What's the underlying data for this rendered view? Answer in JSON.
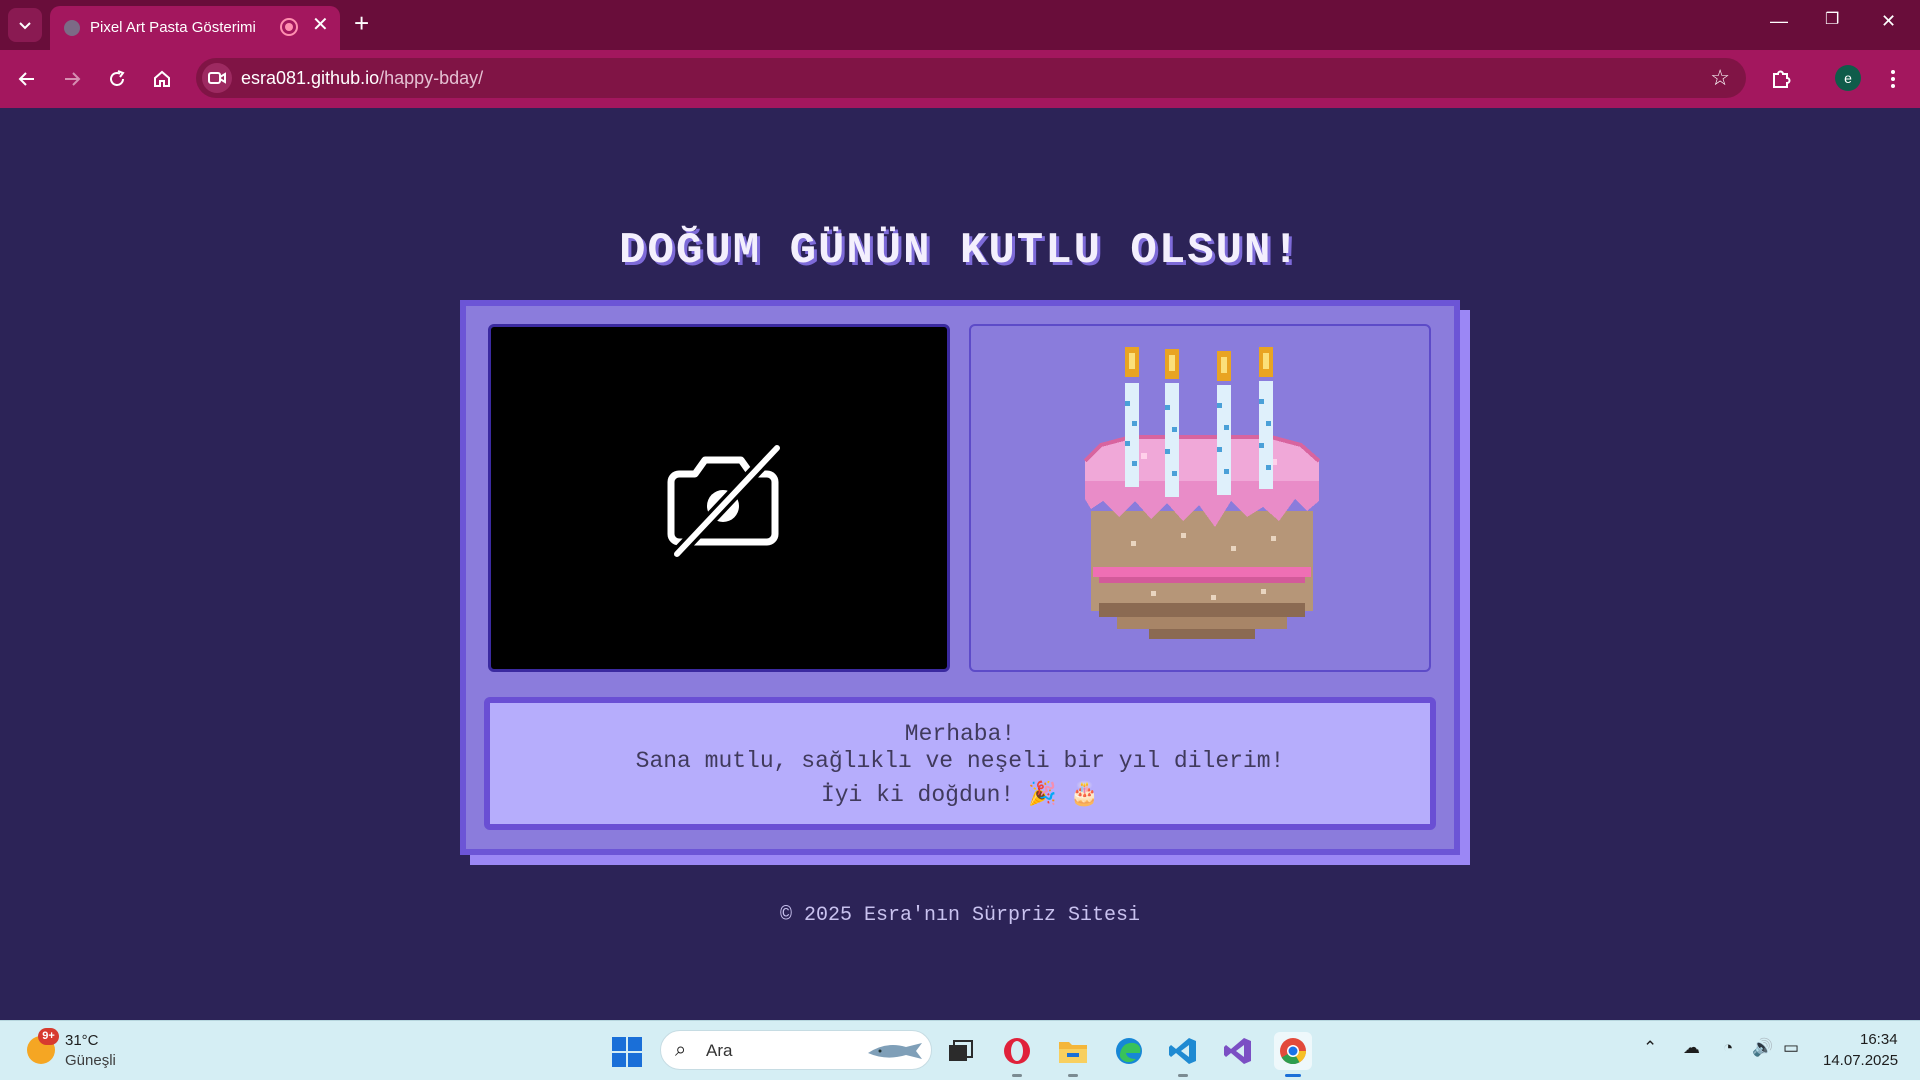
{
  "browser": {
    "tab_title": "Pixel Art Pasta Gösterimi",
    "url_host": "esra081.github.io",
    "url_path": "/happy-bday/",
    "profile_initial": "e"
  },
  "page": {
    "title": "DOĞUM GÜNÜN KUTLU OLSUN!",
    "message_lines": [
      "Merhaba!",
      "Sana mutlu, sağlıklı ve neşeli bir yıl dilerim!",
      "İyi ki doğdun! 🎉 🎂"
    ],
    "footer": "© 2025 Esra'nın Sürpriz Sitesi",
    "camera_icon": "camera-off-icon",
    "cake_candles": 4
  },
  "taskbar": {
    "weather_badge": "9+",
    "weather_temp": "31°C",
    "weather_desc": "Güneşli",
    "search_placeholder": "Ara",
    "clock_time": "16:34",
    "clock_date": "14.07.2025",
    "apps": [
      "task-view",
      "opera",
      "file-explorer",
      "edge",
      "vscode",
      "visual-studio",
      "chrome"
    ]
  },
  "colors": {
    "page_background": "#2c2357",
    "chrome_tabbar": "#690d3a",
    "chrome_toolbar": "#a3175e",
    "card": "#8b7cdc",
    "card_border": "#6c55d6",
    "message_box": "#b6adfc",
    "title_shadow": "#7d6ad8"
  }
}
